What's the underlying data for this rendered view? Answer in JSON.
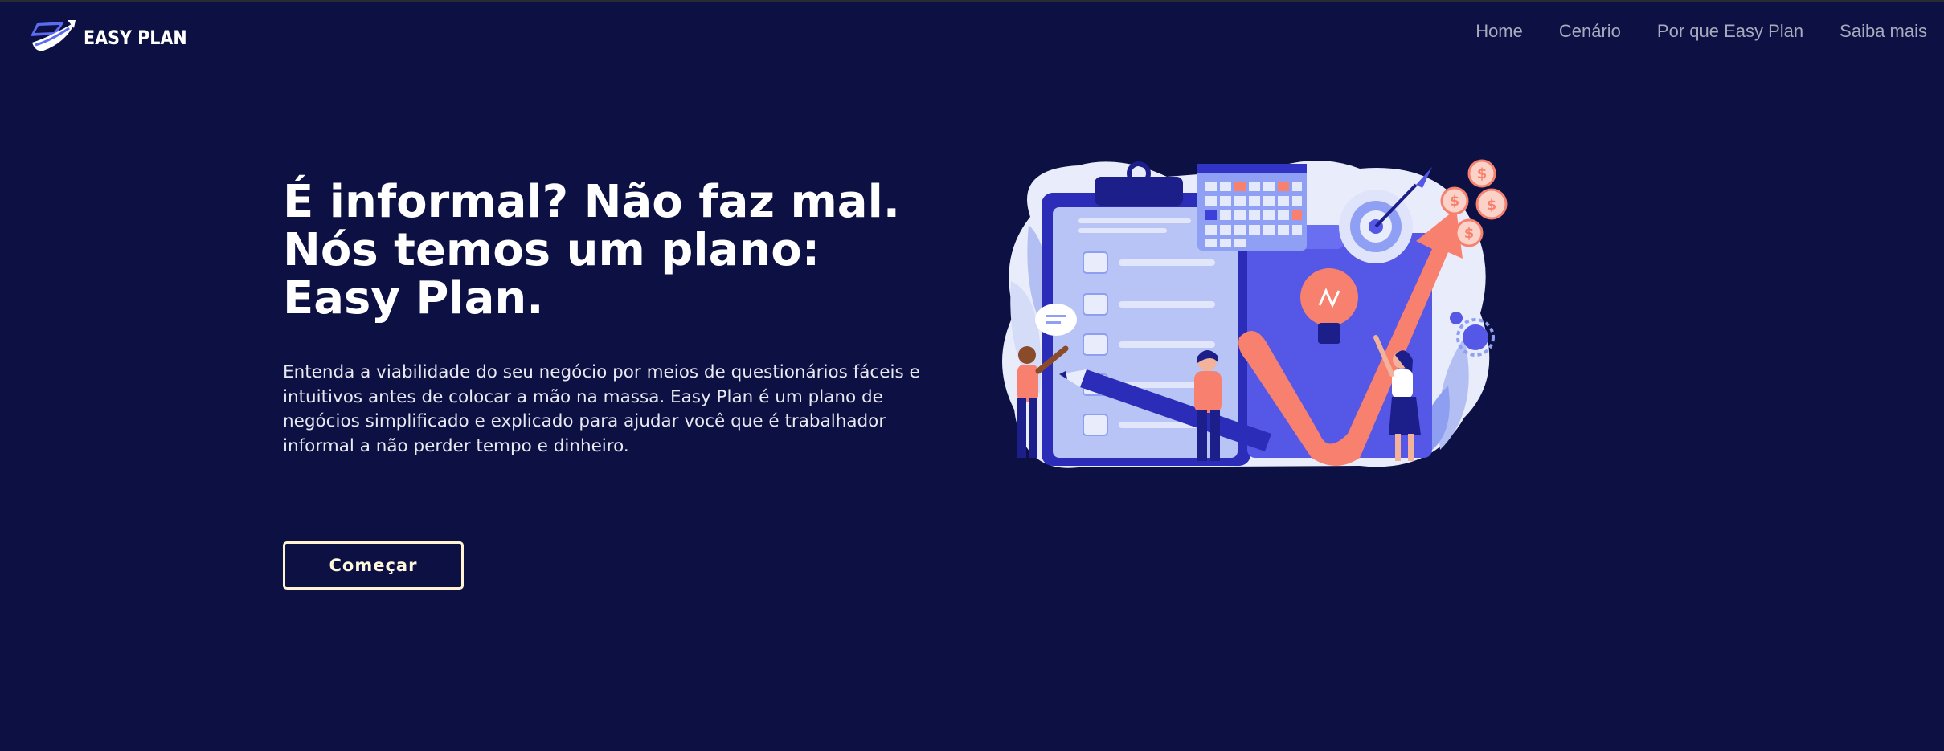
{
  "brand": {
    "name": "EASY PLAN",
    "icon": "easy-plan-logo"
  },
  "nav": {
    "items": [
      {
        "label": "Home"
      },
      {
        "label": "Cenário"
      },
      {
        "label": "Por que Easy Plan"
      },
      {
        "label": "Saiba mais"
      }
    ]
  },
  "hero": {
    "headline": [
      "É informal? Não faz mal.",
      "Nós temos um plano:",
      "Easy Plan."
    ],
    "description": "Entenda a viabilidade do seu negócio por meios de questionários fáceis e intuitivos antes de colocar a mão na massa. Easy Plan é um plano de negócios simplificado e explicado para ajudar você que é trabalhador informal a não perder tempo e dinheiro.",
    "cta_label": "Começar",
    "illustration": "business-plan-illustration"
  },
  "colors": {
    "background": "#0c1042",
    "nav_text": "#a9aabd",
    "cta_border": "#fff4cf",
    "accent_coral": "#f7806e",
    "accent_blue": "#5557e6"
  }
}
